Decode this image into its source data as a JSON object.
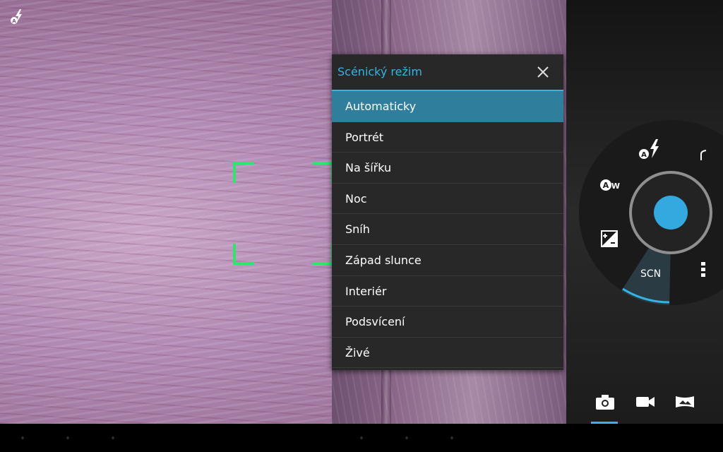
{
  "viewfinder": {
    "flash_indicator_icon": "flash-auto-icon"
  },
  "scene_dialog": {
    "title": "Scénický režim",
    "close_icon": "close-icon",
    "items": [
      {
        "label": "Automaticky",
        "selected": true
      },
      {
        "label": "Portrét",
        "selected": false
      },
      {
        "label": "Na šířku",
        "selected": false
      },
      {
        "label": "Noc",
        "selected": false
      },
      {
        "label": "Sníh",
        "selected": false
      },
      {
        "label": "Západ slunce",
        "selected": false
      },
      {
        "label": "Interiér",
        "selected": false
      },
      {
        "label": "Podsvícení",
        "selected": false
      },
      {
        "label": "Živé",
        "selected": false
      }
    ]
  },
  "control_pie": {
    "scene_label": "SCN",
    "icons": [
      "flash-auto-icon",
      "settings-corner-icon",
      "white-balance-auto-icon",
      "exposure-icon",
      "more-options-icon"
    ],
    "shutter_icon": "shutter-button-icon"
  },
  "mode_switcher": {
    "modes": [
      "camera-icon",
      "video-icon",
      "panorama-icon"
    ],
    "active": "camera-icon"
  },
  "colors": {
    "accent": "#33b5e5",
    "selected_row": "#2f7f9c",
    "focus": "#2ee66e",
    "dialog_bg": "#282828"
  }
}
